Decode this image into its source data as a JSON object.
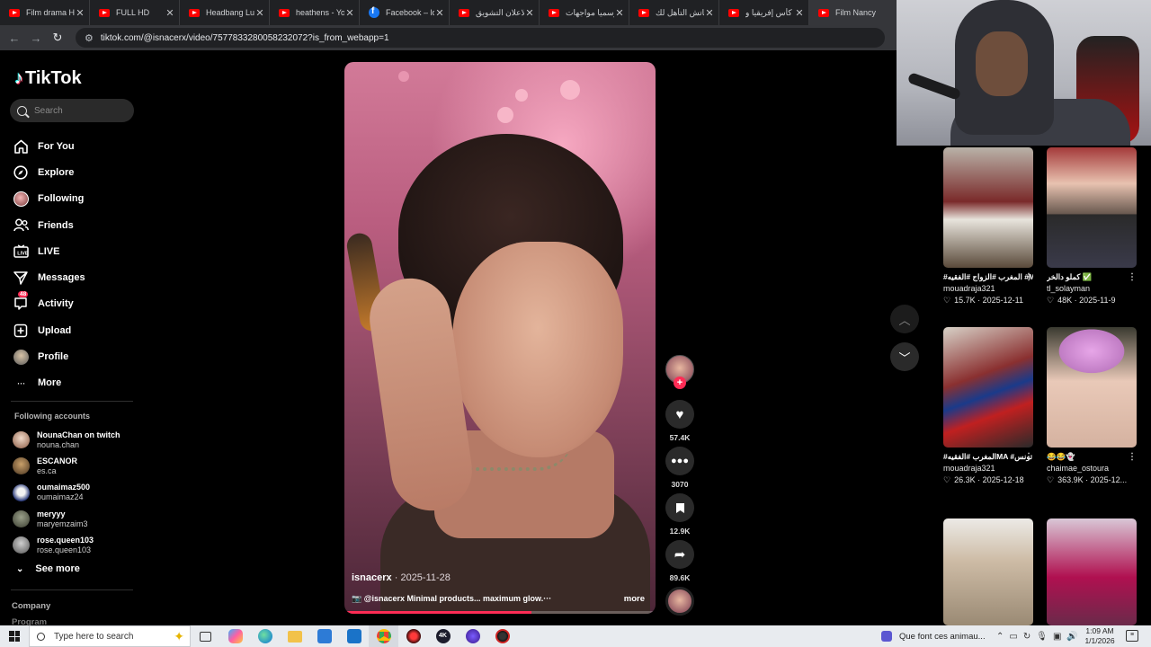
{
  "browser": {
    "tabs": [
      {
        "title": "Film drama HD",
        "favicon": "youtube-icon"
      },
      {
        "title": "FULL HD",
        "favicon": "youtube-icon"
      },
      {
        "title": "Headbang Lull",
        "favicon": "youtube-icon"
      },
      {
        "title": "heathens - You",
        "favicon": "youtube-icon"
      },
      {
        "title": "Facebook – log",
        "favicon": "facebook-icon"
      },
      {
        "title": "الاعلان التشويق",
        "favicon": "youtube-icon"
      },
      {
        "title": "رسميا مواجهات",
        "favicon": "youtube-icon"
      },
      {
        "title": "ماتش التأهل لك",
        "favicon": "youtube-icon"
      },
      {
        "title": "كأس إفريقيا و",
        "favicon": "youtube-icon"
      },
      {
        "title": "Film Nancy",
        "favicon": "youtube-icon"
      }
    ],
    "url": "tiktok.com/@isnacerx/video/7577833280058232072?is_from_webapp=1"
  },
  "sidebar": {
    "brand": "TikTok",
    "search_placeholder": "Search",
    "nav": [
      {
        "label": "For You",
        "icon": "home-icon"
      },
      {
        "label": "Explore",
        "icon": "compass-icon"
      },
      {
        "label": "Following",
        "icon": "following-avatar-icon"
      },
      {
        "label": "Friends",
        "icon": "friends-icon"
      },
      {
        "label": "LIVE",
        "icon": "live-icon"
      },
      {
        "label": "Messages",
        "icon": "messages-icon"
      },
      {
        "label": "Activity",
        "icon": "activity-icon",
        "badge": "48"
      },
      {
        "label": "Upload",
        "icon": "upload-icon"
      },
      {
        "label": "Profile",
        "icon": "profile-avatar-icon"
      },
      {
        "label": "More",
        "icon": "more-icon"
      }
    ],
    "following_heading": "Following accounts",
    "following": [
      {
        "name": "NounaChan on twitch",
        "handle": "nouna.chan"
      },
      {
        "name": "ESCANOR",
        "handle": "es.ca"
      },
      {
        "name": "oumaimaz500",
        "handle": "oumaimaz24"
      },
      {
        "name": "meryyy",
        "handle": "maryemzaim3"
      },
      {
        "name": "rose.queen103",
        "handle": "rose.queen103"
      }
    ],
    "see_more": "See more",
    "company": "Company",
    "program": "Program"
  },
  "video": {
    "author": "isnacerx",
    "date": "2025-11-28",
    "description": "📷 @isnacerx Minimal products... maximum glow.···",
    "more": "more",
    "progress": 0.6
  },
  "actions": {
    "likes": "57.4K",
    "comments": "3070",
    "saves": "12.9K",
    "shares": "89.6K"
  },
  "grid": [
    {
      "caption": "#المغرب #الزواج #الفقيه #MA #شرنسCP_#بلجيكا#BE...",
      "user": "mouadraja321",
      "likes": "15.7K",
      "date": "2025-12-11"
    },
    {
      "caption": "كملو دالخر ✅",
      "user": "tl_solayman",
      "likes": "48K",
      "date": "2025-11-9"
    },
    {
      "caption": "#المغرب #الفقيهMA #تونس TN_#الجزائرDZ#تركياTR...",
      "user": "mouadraja321",
      "likes": "26.3K",
      "date": "2025-12-18"
    },
    {
      "caption": "😂😂👻",
      "user": "chaimae_ostoura",
      "likes": "363.9K",
      "date": "2025-12..."
    },
    {
      "caption": "",
      "user": "",
      "likes": "",
      "date": ""
    },
    {
      "caption": "",
      "user": "",
      "likes": "",
      "date": ""
    }
  ],
  "taskbar": {
    "search_placeholder": "Type here to search",
    "news": "Que font ces animau...",
    "time": "1:09 AM",
    "date": "1/1/2026"
  }
}
